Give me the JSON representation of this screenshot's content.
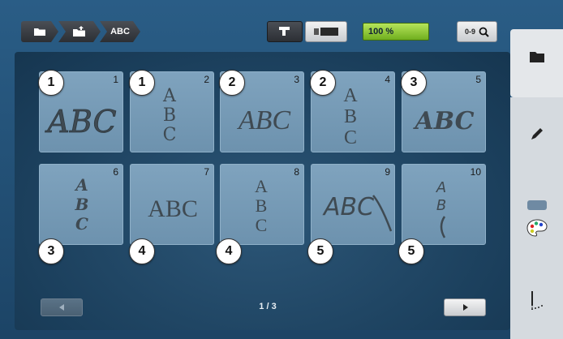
{
  "breadcrumb": {
    "root_icon": "folder-icon",
    "upload_icon": "folder-upload-icon",
    "current": "ABC"
  },
  "toolbar": {
    "machine_icon": "sewing-machine-icon",
    "hoop_icon": "hoop-icon",
    "zoom_value": "100 %",
    "zoom_color": "#8fce36",
    "numeric_label": "0-9",
    "search_icon": "search-icon"
  },
  "grid": {
    "items": [
      {
        "index": "1",
        "badge": "1"
      },
      {
        "index": "2",
        "badge": "1"
      },
      {
        "index": "3",
        "badge": "2"
      },
      {
        "index": "4",
        "badge": "2"
      },
      {
        "index": "5",
        "badge": "3"
      },
      {
        "index": "6",
        "badge": "3"
      },
      {
        "index": "7",
        "badge": "4"
      },
      {
        "index": "8",
        "badge": "4"
      },
      {
        "index": "9",
        "badge": "5"
      },
      {
        "index": "10",
        "badge": "5"
      }
    ]
  },
  "pager": {
    "label": "1 / 3",
    "prev_icon": "triangle-left-icon",
    "next_icon": "triangle-right-icon"
  },
  "side_tabs": {
    "folder_icon": "folder-icon",
    "edit_icon": "pencil-icon",
    "color_icon": "palette-icon",
    "stitch_icon": "needle-icon"
  }
}
